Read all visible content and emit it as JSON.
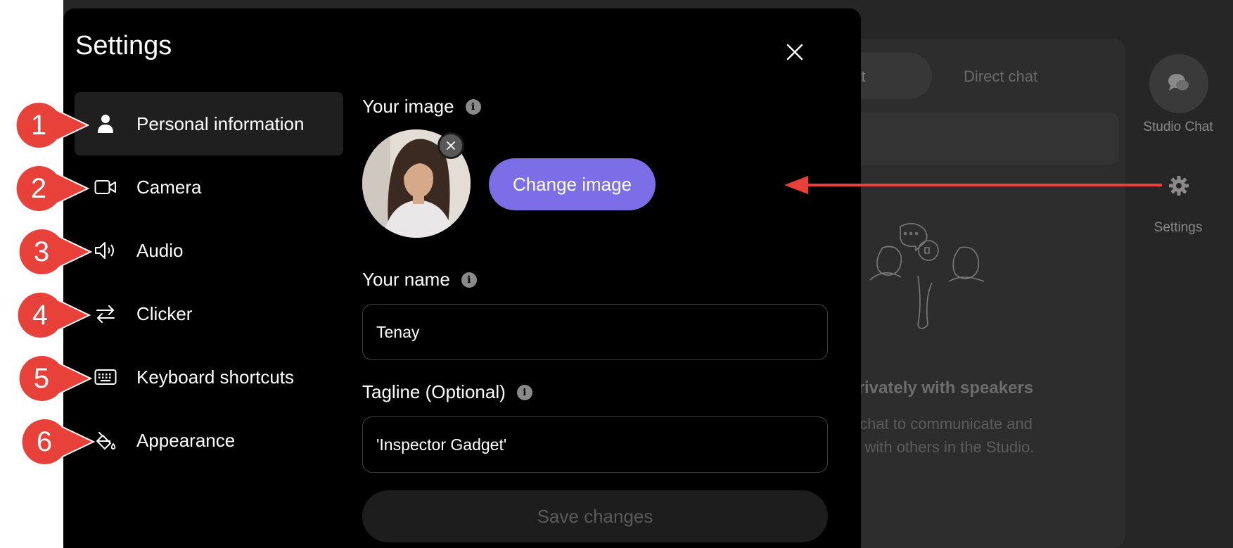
{
  "background": {
    "chat_tabs": {
      "active_fragment": "hat",
      "direct": "Direct chat"
    },
    "rail": {
      "studio_chat_label": "Studio Chat",
      "settings_label": "Settings"
    },
    "empty_state": {
      "title_fragment": "privately with speakers",
      "line1_fragment": "s chat to communicate and",
      "line2_fragment": "te with others in the Studio."
    }
  },
  "modal": {
    "title": "Settings",
    "nav": [
      {
        "label": "Personal information",
        "icon": "person-icon",
        "active": true
      },
      {
        "label": "Camera",
        "icon": "camera-icon",
        "active": false
      },
      {
        "label": "Audio",
        "icon": "speaker-icon",
        "active": false
      },
      {
        "label": "Clicker",
        "icon": "arrows-swap-icon",
        "active": false
      },
      {
        "label": "Keyboard shortcuts",
        "icon": "keyboard-icon",
        "active": false
      },
      {
        "label": "Appearance",
        "icon": "paint-bucket-icon",
        "active": false
      }
    ],
    "image_section": {
      "label": "Your image",
      "change_button": "Change image"
    },
    "name_section": {
      "label": "Your name",
      "value": "Tenay"
    },
    "tagline_section": {
      "label": "Tagline (Optional)",
      "value": "'Inspector Gadget'"
    },
    "save_button": "Save changes"
  },
  "callouts": [
    "1",
    "2",
    "3",
    "4",
    "5",
    "6"
  ],
  "colors": {
    "accent": "#7c6ee6",
    "callout": "#e8413a",
    "modal_bg": "#000000",
    "app_bg": "#262626"
  }
}
